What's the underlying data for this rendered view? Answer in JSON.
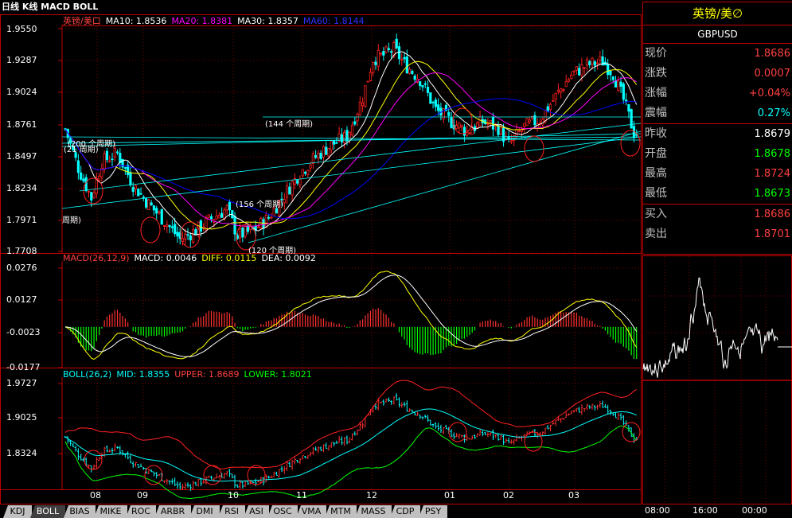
{
  "header": {
    "title": "日线 K线 MACD BOLL"
  },
  "kline": {
    "legend": {
      "name": "英镑/美口",
      "ma10": "MA10: 1.8536",
      "ma20": "MA20: 1.8381",
      "ma30": "MA30: 1.8357",
      "ma60": "MA60: 1.8144"
    },
    "yticks": [
      "1.9550",
      "1.9287",
      "1.9024",
      "1.8761",
      "1.8497",
      "1.8234",
      "1.7971",
      "1.7708"
    ],
    "cycle_labels": [
      "(144 个周期)",
      "(200 个周期)",
      "(21 周期)",
      "周期)",
      "(156 个周期)",
      "(120 个周期)"
    ]
  },
  "macd": {
    "legend": {
      "title": "MACD(26,12,9)",
      "macd": "MACD: 0.0046",
      "diff": "DIFF: 0.0115",
      "dea": "DEA: 0.0092"
    },
    "yticks": [
      "0.0276",
      "0.0127",
      "-0.0023",
      "-0.0177"
    ]
  },
  "boll": {
    "legend": {
      "title": "BOLL(26,2)",
      "mid": "MID: 1.8355",
      "upper": "UPPER: 1.8689",
      "lower": "LOWER: 1.8021"
    },
    "yticks": [
      "1.9727",
      "1.9025",
      "1.8324"
    ]
  },
  "xaxis": {
    "months": [
      "08",
      "09",
      "10",
      "11",
      "12",
      "01",
      "02",
      "03"
    ]
  },
  "tabs": [
    "KDJ",
    "BOLL",
    "BIAS",
    "MIKE",
    "ROC",
    "ARBR",
    "DMI",
    "RSI",
    "ASI",
    "OSC",
    "VMA",
    "MTM",
    "MASS",
    "CDP",
    "PSY"
  ],
  "active_tab": "BOLL",
  "quote": {
    "name": "英镑/美∅",
    "code": "GBPUSD",
    "rows": [
      {
        "label": "现价",
        "value": "1.8686",
        "color": "#ff4040"
      },
      {
        "label": "涨跌",
        "value": "0.0007",
        "color": "#ff4040"
      },
      {
        "label": "涨幅",
        "value": "+0.04%",
        "color": "#ff4040"
      },
      {
        "label": "震幅",
        "value": "0.27%",
        "color": "#00ffff"
      },
      {
        "label": "昨收",
        "value": "1.8679",
        "color": "#ffffff"
      },
      {
        "label": "开盘",
        "value": "1.8678",
        "color": "#00ff00"
      },
      {
        "label": "最高",
        "value": "1.8724",
        "color": "#ff4040"
      },
      {
        "label": "最低",
        "value": "1.8673",
        "color": "#00ff00"
      },
      {
        "label": "买入",
        "value": "1.8686",
        "color": "#ff4040"
      },
      {
        "label": "卖出",
        "value": "1.8701",
        "color": "#ff4040"
      }
    ]
  },
  "minute_axis": [
    "08:00",
    "16:00",
    "00:00"
  ],
  "colors": {
    "grid_red": "#c00000",
    "up": "#ff2020",
    "down": "#00ffff",
    "ma10": "#ffffff",
    "ma20": "#ffff00",
    "ma30": "#ff00ff",
    "ma60": "#0000ff",
    "trend": "#00ffff"
  },
  "chart_data": {
    "type": "candlestick",
    "title": "日线 K线 MACD BOLL",
    "series_name": "英镑/美口",
    "x_months": [
      "08",
      "09",
      "10",
      "11",
      "12",
      "01",
      "02",
      "03"
    ],
    "ylim_price": [
      1.7708,
      1.955
    ],
    "close_anchor_points": [
      [
        0,
        1.872
      ],
      [
        5,
        1.84
      ],
      [
        10,
        1.815
      ],
      [
        14,
        1.845
      ],
      [
        20,
        1.852
      ],
      [
        26,
        1.826
      ],
      [
        32,
        1.81
      ],
      [
        38,
        1.796
      ],
      [
        44,
        1.781
      ],
      [
        50,
        1.788
      ],
      [
        56,
        1.798
      ],
      [
        62,
        1.806
      ],
      [
        66,
        1.784
      ],
      [
        72,
        1.788
      ],
      [
        78,
        1.799
      ],
      [
        84,
        1.818
      ],
      [
        90,
        1.836
      ],
      [
        96,
        1.849
      ],
      [
        102,
        1.859
      ],
      [
        108,
        1.866
      ],
      [
        114,
        1.898
      ],
      [
        118,
        1.93
      ],
      [
        122,
        1.933
      ],
      [
        126,
        1.938
      ],
      [
        130,
        1.926
      ],
      [
        136,
        1.913
      ],
      [
        142,
        1.888
      ],
      [
        148,
        1.878
      ],
      [
        154,
        1.87
      ],
      [
        160,
        1.878
      ],
      [
        166,
        1.873
      ],
      [
        170,
        1.859
      ],
      [
        176,
        1.874
      ],
      [
        182,
        1.88
      ],
      [
        188,
        1.899
      ],
      [
        194,
        1.917
      ],
      [
        200,
        1.925
      ],
      [
        206,
        1.928
      ],
      [
        210,
        1.918
      ],
      [
        214,
        1.896
      ],
      [
        218,
        1.869
      ]
    ],
    "macd_range": [
      -0.0177,
      0.0276
    ],
    "boll_range": [
      1.78,
      1.9727
    ]
  }
}
